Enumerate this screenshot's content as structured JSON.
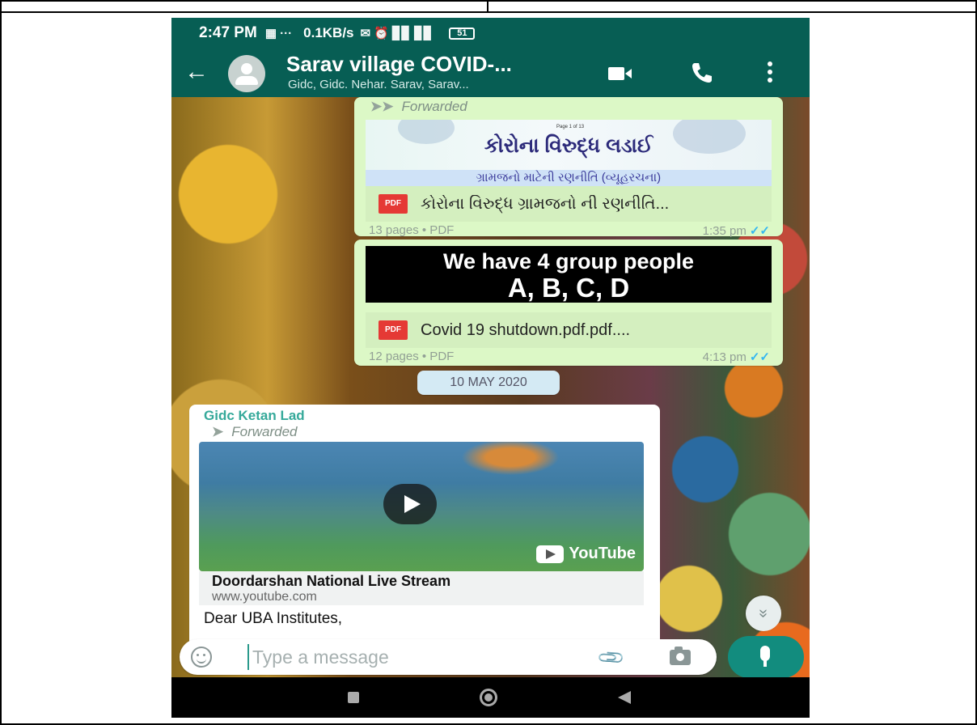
{
  "status_bar": {
    "time": "2:47 PM",
    "notification_icons": "▦ ···",
    "net_speed": "0.1KB/s",
    "signal_icons": "✉ ⏰ ▊▊ ▊▊",
    "battery": "51"
  },
  "header": {
    "title": "Sarav village COVID-...",
    "subtitle": "Gidc, Gidc. Nehar. Sarav, Sarav...",
    "icons": [
      "back-arrow-icon",
      "group-avatar",
      "video-call-icon",
      "voice-call-icon",
      "more-menu-icon"
    ],
    "accent": "#075e54"
  },
  "messages": {
    "msg1": {
      "forwarded_label": "Forwarded",
      "preview_tiny": "Page 1 of 13",
      "preview_title": "કોરોના વિરુદ્ધ લડાઈ",
      "preview_subtitle": "ગ્રામજનો માટેની રણનીતિ (વ્યૂહરચના)",
      "file_type": "PDF",
      "file_name": "કોરોના વિરુદ્ધ ગ્રામજનો ની રણનીતિ...",
      "meta": "13 pages • PDF",
      "time": "1:35 pm",
      "ticks": "✓✓"
    },
    "msg2": {
      "preview_line1": "We have 4 group people",
      "preview_line2": "A, B, C, D",
      "file_type": "PDF",
      "file_name": "Covid 19 shutdown.pdf.pdf....",
      "meta": "12 pages • PDF",
      "time": "4:13 pm",
      "ticks": "✓✓"
    },
    "date_divider": "10 MAY 2020",
    "msg3": {
      "sender": "Gidc Ketan Lad",
      "forwarded_label": "Forwarded",
      "video_brand": "YouTube",
      "link_title": "Doordarshan National Live Stream",
      "link_url": "www.youtube.com",
      "text": "Dear UBA Institutes,"
    }
  },
  "scroll_down_icon": "»",
  "composer": {
    "placeholder": "Type a message",
    "value": "",
    "attach_glyph": "✉"
  },
  "colors": {
    "outgoing_bubble": "#dcf8c6",
    "incoming_bubble": "#ffffff",
    "sender_name": "#35a99a",
    "tick_read": "#34b7f1",
    "mic_button": "#128c7e"
  }
}
